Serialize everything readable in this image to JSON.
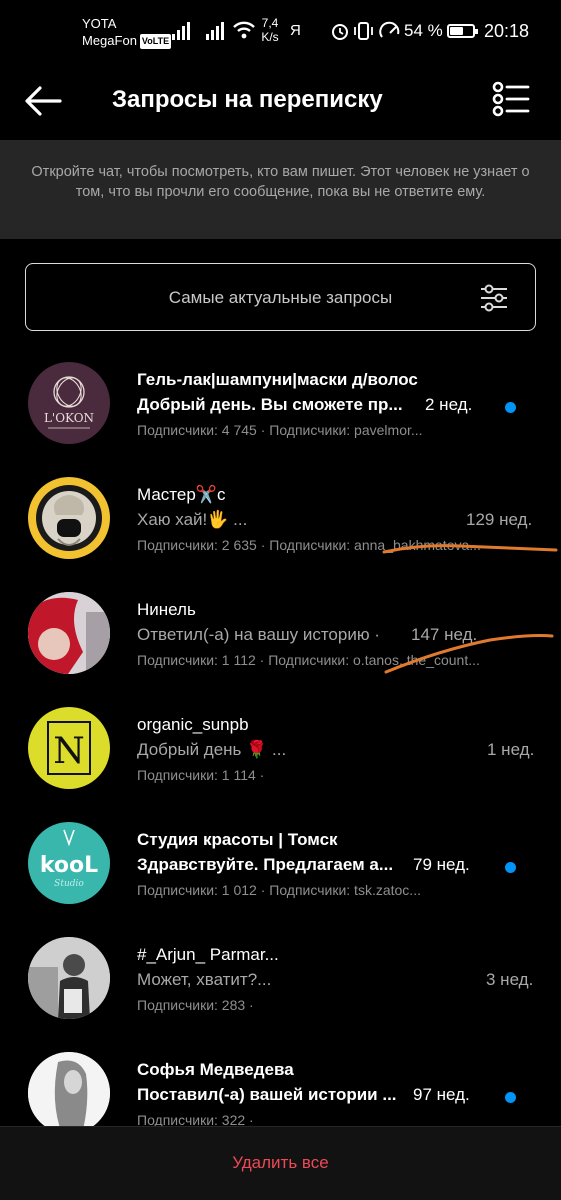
{
  "status_bar": {
    "carrier_1": "YOTA",
    "carrier_2": "MegaFon",
    "volte": "VoLTE",
    "speed_value": "7,4",
    "speed_unit": "K/s",
    "ya": "Я",
    "battery_percent": "54 %",
    "battery_level": 0.54,
    "time": "20:18"
  },
  "header": {
    "title": "Запросы на переписку",
    "back_icon": "arrow-left-icon",
    "menu_icon": "checklist-icon"
  },
  "banner": {
    "text": "Откройте чат, чтобы посмотреть, кто вам пишет. Этот человек не узнает о том, что вы прочли его сообщение, пока вы не ответите ему."
  },
  "filter": {
    "label": "Самые актуальные запросы",
    "icon": "sliders-icon"
  },
  "requests": [
    {
      "name": "Гель-лак|шампуни|маски д/волос",
      "message": "Добрый день. Вы сможете пр...",
      "time": "2 нед.",
      "meta": "Подписчики: 4 745 · Подписчики: pavelmor...",
      "unread": true,
      "avatar_text": "L'OKON"
    },
    {
      "name": "Мастер✂️с",
      "message": "Хаю хай!🖐 ...",
      "time": "129 нед.",
      "meta": "Подписчики: 2 635 · Подписчики: anna_bakhmatova...",
      "unread": false,
      "avatar_text": ""
    },
    {
      "name": "Нинель",
      "message": "Ответил(-а) на вашу историю ·",
      "time": "147 нед.",
      "meta": "Подписчики: 1 112 · Подписчики: o.tanos, the_count...",
      "unread": false,
      "avatar_text": ""
    },
    {
      "name": "organic_sunpb",
      "message": "Добрый день 🌹 ...",
      "time": "1 нед.",
      "meta": "Подписчики: 1 114 ·",
      "unread": false,
      "avatar_text": "N"
    },
    {
      "name": "Студия красоты | Томск",
      "message": "Здравствуйте. Предлагаем а...",
      "time": "79 нед.",
      "meta": "Подписчики: 1 012 · Подписчики: tsk.zatoc...",
      "unread": true,
      "avatar_text": "kooL"
    },
    {
      "name": "#_Arjun_ Parmar...",
      "message": "Может, хватит?...",
      "time": "3 нед.",
      "meta": "Подписчики: 283 ·",
      "unread": false,
      "avatar_text": ""
    },
    {
      "name": "Софья Медведева",
      "message": "Поставил(-а) вашей истории ...",
      "time": "97 нед.",
      "meta": "Подписчики: 322 ·",
      "unread": true,
      "avatar_text": ""
    }
  ],
  "footer": {
    "delete_all": "Удалить все"
  },
  "colors": {
    "background": "#000000",
    "banner": "#262626",
    "unread_dot": "#0095f6",
    "delete": "#ed4956",
    "scribble": "#e07a2e"
  }
}
